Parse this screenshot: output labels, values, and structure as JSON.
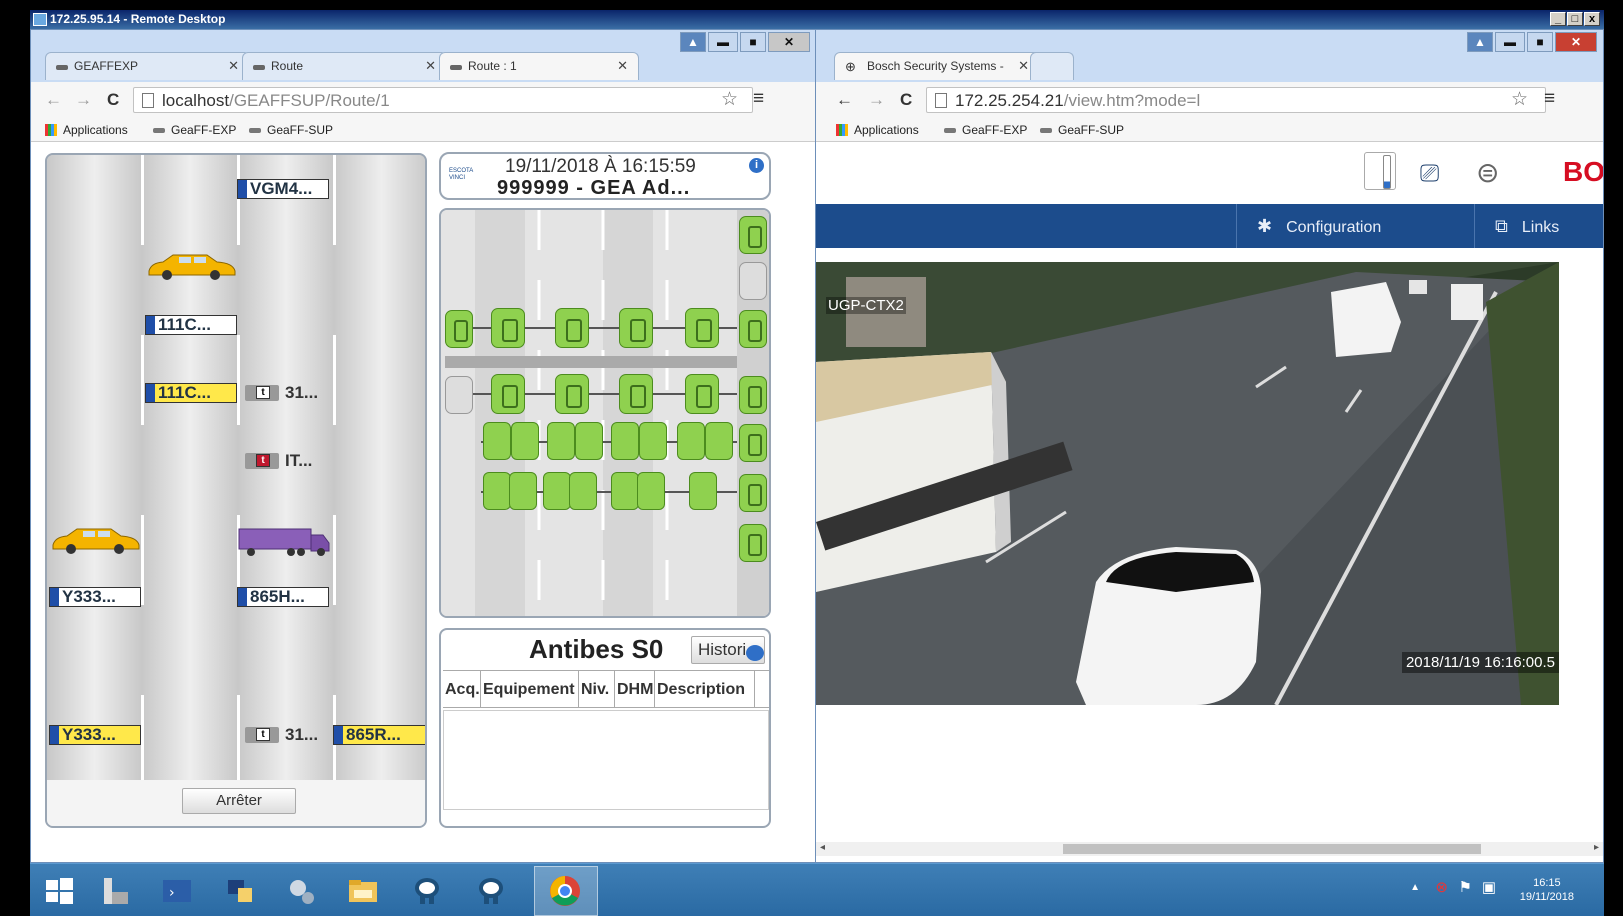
{
  "rdp": {
    "title": "172.25.95.14 - Remote Desktop",
    "btn_min": "_",
    "btn_max": "□",
    "btn_close": "x"
  },
  "left": {
    "tabs": [
      "GEAFFEXP",
      "Route",
      "Route : 1"
    ],
    "url_host": "localhost",
    "url_path": "/GEAFFSUP/Route/1",
    "bookmarks": [
      "Applications",
      "GeaFF-EXP",
      "GeaFF-SUP"
    ],
    "road": {
      "plates": [
        "VGM4...",
        "111C...",
        "111C...",
        "Y333...",
        "865H...",
        "Y333...",
        "865R..."
      ],
      "tags": [
        "31...",
        "IT...",
        "31..."
      ],
      "tag_glyphs": [
        "t",
        "t",
        "t"
      ],
      "stop_label": "Arrêter"
    },
    "info": {
      "logo_text": "ESCOTA VINCI",
      "datetime": "19/11/2018 À 16:15:59",
      "site": "999999 - GEA Ad...",
      "info_glyph": "i"
    },
    "alarms": {
      "title": "Antibes S0",
      "history_btn": "Histori",
      "columns": [
        "Acq.",
        "Equipement",
        "Niv.",
        "DHM",
        "Description"
      ]
    }
  },
  "right": {
    "tab": "Bosch Security Systems -",
    "url_host": "172.25.254.21",
    "url_path": "/view.htm?mode=l",
    "bookmarks": [
      "Applications",
      "GeaFF-EXP",
      "GeaFF-SUP"
    ],
    "logo": "BOSCH",
    "nav": {
      "config": "Configuration",
      "link": "Links"
    },
    "camera": {
      "label": "UGP-CTX2",
      "timestamp": "2018/11/19  16:16:00.5"
    }
  },
  "taskbar": {
    "time": "16:15",
    "date": "19/11/2018"
  },
  "colors": {
    "device_green": "#8fd14f",
    "bosch_red": "#d60d22",
    "nav_blue": "#1c4c8c"
  }
}
